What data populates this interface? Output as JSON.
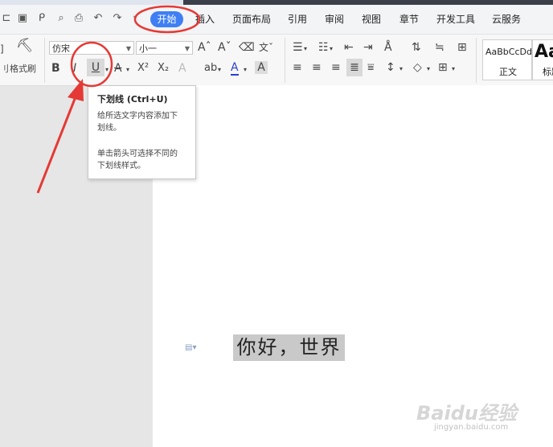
{
  "menu": {
    "tabs": [
      {
        "label": "开始",
        "active": true
      },
      {
        "label": "插入"
      },
      {
        "label": "页面布局"
      },
      {
        "label": "引用"
      },
      {
        "label": "审阅"
      },
      {
        "label": "视图"
      },
      {
        "label": "章节"
      },
      {
        "label": "开发工具"
      },
      {
        "label": "云服务"
      }
    ]
  },
  "ribbon": {
    "format_painter_label": "格式刷",
    "font_name": "仿宋",
    "font_size": "小一",
    "styles": [
      {
        "preview": "AaBbCcDd",
        "label": "正文"
      },
      {
        "preview": "Aa",
        "label": "标题"
      }
    ],
    "bold_label": "B",
    "italic_label": "I",
    "underline_label": "U",
    "strike_label": "A",
    "superscript_label": "X²",
    "subscript_label": "X₂",
    "font_color_label": "A",
    "char_shading_label": "A",
    "highlight_label": "ab"
  },
  "tooltip": {
    "title": "下划线 (Ctrl+U)",
    "desc_lines": [
      "给所选文字内容添加下",
      "划线。"
    ],
    "hint_lines": [
      "单击箭头可选择不同的",
      "下划线样式。"
    ]
  },
  "document": {
    "text": "你好，世界"
  },
  "watermark": {
    "brand": "Baidu经验",
    "url": "jingyan.baidu.com"
  },
  "colors": {
    "accent": "#3f7ff3",
    "annotation": "#e53935",
    "selection": "#c9c9c9"
  }
}
